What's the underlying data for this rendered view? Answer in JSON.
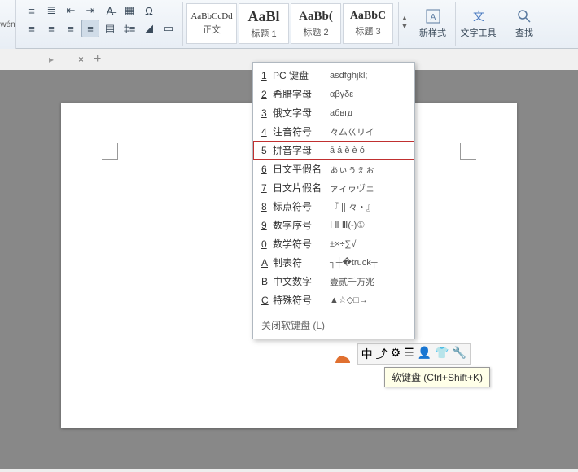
{
  "ribbon": {
    "left_label": "wén",
    "align_buttons": [
      "左对齐",
      "居中",
      "右对齐",
      "两端对齐",
      "分散对齐"
    ],
    "styles": [
      {
        "preview": "AaBbCcDd",
        "label": "正文",
        "size": "11px",
        "weight": "normal"
      },
      {
        "preview": "AaBl",
        "label": "标题 1",
        "size": "18px",
        "weight": "bold"
      },
      {
        "preview": "AaBb(",
        "label": "标题 2",
        "size": "15px",
        "weight": "bold"
      },
      {
        "preview": "AaBbC",
        "label": "标题 3",
        "size": "14px",
        "weight": "bold"
      }
    ],
    "new_style": "新样式",
    "text_tools": "文字工具",
    "find": "查找"
  },
  "tabs": {
    "close_glyph": "×",
    "add_glyph": "+"
  },
  "dropdown": {
    "items": [
      {
        "key": "1",
        "label": "PC 键盘",
        "sample": "asdfghjkl;"
      },
      {
        "key": "2",
        "label": "希腊字母",
        "sample": "αβγδε"
      },
      {
        "key": "3",
        "label": "俄文字母",
        "sample": "абвгд"
      },
      {
        "key": "4",
        "label": "注音符号",
        "sample": "々厶巜リイ"
      },
      {
        "key": "5",
        "label": "拼音字母",
        "sample": "ā á ě è ó",
        "highlighted": true
      },
      {
        "key": "6",
        "label": "日文平假名",
        "sample": "ぁぃぅぇぉ"
      },
      {
        "key": "7",
        "label": "日文片假名",
        "sample": "ァィゥヴェ"
      },
      {
        "key": "8",
        "label": "标点符号",
        "sample": "『 || 々・』"
      },
      {
        "key": "9",
        "label": "数字序号",
        "sample": "Ⅰ Ⅱ Ⅲ(-)①"
      },
      {
        "key": "0",
        "label": "数学符号",
        "sample": "±×÷∑√"
      },
      {
        "key": "A",
        "label": "制表符",
        "sample": "┐┼�truck┬"
      },
      {
        "key": "B",
        "label": "中文数字",
        "sample": "壹贰千万兆"
      },
      {
        "key": "C",
        "label": "特殊符号",
        "sample": "▲☆◇□→"
      }
    ],
    "close": "关闭软键盘 (L)"
  },
  "tooltip": "软键盘 (Ctrl+Shift+K)",
  "status_icons": [
    "中",
    "⤴",
    "⚙",
    "☰",
    "👤",
    "👕",
    "🔧"
  ]
}
